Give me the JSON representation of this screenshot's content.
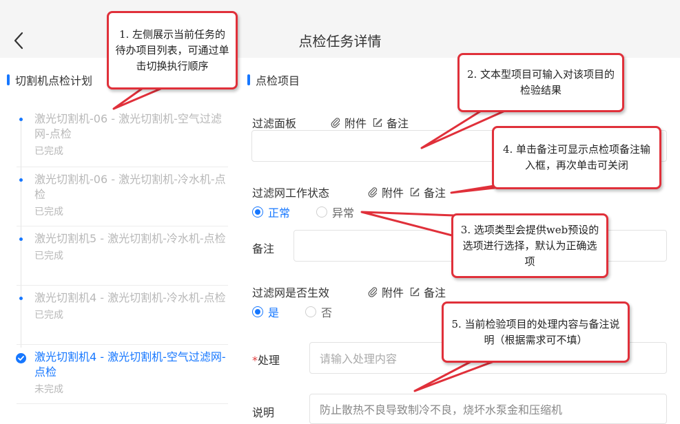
{
  "header": {
    "title": "点检任务详情"
  },
  "sidebar": {
    "title": "切割机点检计划",
    "tasks": [
      {
        "name": "激光切割机-06 - 激光切割机-空气过滤网-点检",
        "status": "已完成"
      },
      {
        "name": "激光切割机-06 - 激光切割机-冷水机-点检",
        "status": "已完成"
      },
      {
        "name": "激光切割机5 - 激光切割机-冷水机-点检",
        "status": "已完成"
      },
      {
        "name": "激光切割机4 - 激光切割机-冷水机-点检",
        "status": "已完成"
      },
      {
        "name": "激光切割机4 - 激光切割机-空气过滤网-点检",
        "status": "未完成"
      }
    ]
  },
  "main": {
    "title": "点检项目",
    "attach_label": "附件",
    "remark_label": "备注",
    "items": [
      {
        "label": "过滤面板",
        "value": ""
      },
      {
        "label": "过滤网工作状态",
        "options": [
          "正常",
          "异常"
        ],
        "selected": "正常"
      },
      {
        "label": "过滤网是否生效",
        "options": [
          "是",
          "否"
        ],
        "selected": "是"
      }
    ],
    "remark_field_label": "备注",
    "process": {
      "required_mark": "*",
      "label": "处理",
      "placeholder": "请输入处理内容"
    },
    "note": {
      "label": "说明",
      "value": "防止散热不良导致制冷不良，烧坏水泵金和压缩机"
    }
  },
  "callouts": [
    "1. 左侧展示当前任务的待办项目列表，可通过单击切换执行顺序",
    "2. 文本型项目可输入对该项目的检验结果",
    "4. 单击备注可显示点检项备注输入框，再次单击可关闭",
    "3. 选项类型会提供web预设的选项进行选择，默认为正确选项",
    "5. 当前检验项目的处理内容与备注说明（根据需求可不填）"
  ],
  "colors": {
    "accent": "#1677ff",
    "callout_border": "#e0303a",
    "required": "#e03c3c"
  }
}
